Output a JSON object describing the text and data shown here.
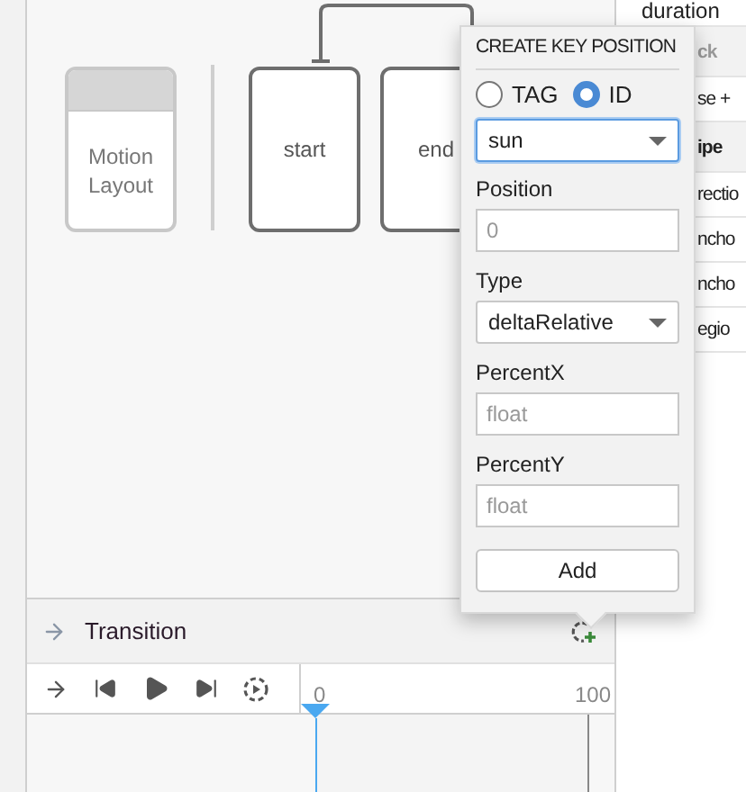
{
  "canvas": {
    "nodes": [
      {
        "kind": "layout",
        "label": "Motion Layout"
      },
      {
        "kind": "constraint_set",
        "label": "start"
      },
      {
        "kind": "constraint_set",
        "label": "end"
      }
    ]
  },
  "transition_panel": {
    "title": "Transition"
  },
  "timeline": {
    "start_label": "0",
    "end_label": "100",
    "level": 0
  },
  "properties": [
    {
      "kind": "row",
      "text": "duration"
    },
    {
      "kind": "header",
      "text": "ck"
    },
    {
      "kind": "row",
      "text": "se +"
    },
    {
      "kind": "section",
      "text": "ipe"
    },
    {
      "kind": "row",
      "text": "rectio"
    },
    {
      "kind": "row",
      "text": "ncho"
    },
    {
      "kind": "row",
      "text": "ncho"
    },
    {
      "kind": "row",
      "text": "egio"
    }
  ],
  "popover": {
    "title": "CREATE KEY POSITION",
    "target_options": [
      {
        "label": "TAG",
        "selected": false
      },
      {
        "label": "ID",
        "selected": true
      }
    ],
    "id_select": {
      "value": "sun"
    },
    "fields": [
      {
        "kind": "text",
        "label": "Position",
        "placeholder": "0"
      },
      {
        "kind": "select",
        "label": "Type",
        "value": "deltaRelative"
      },
      {
        "kind": "text",
        "label": "PercentX",
        "placeholder": "float"
      },
      {
        "kind": "text",
        "label": "PercentY",
        "placeholder": "float"
      }
    ],
    "button": "Add"
  }
}
